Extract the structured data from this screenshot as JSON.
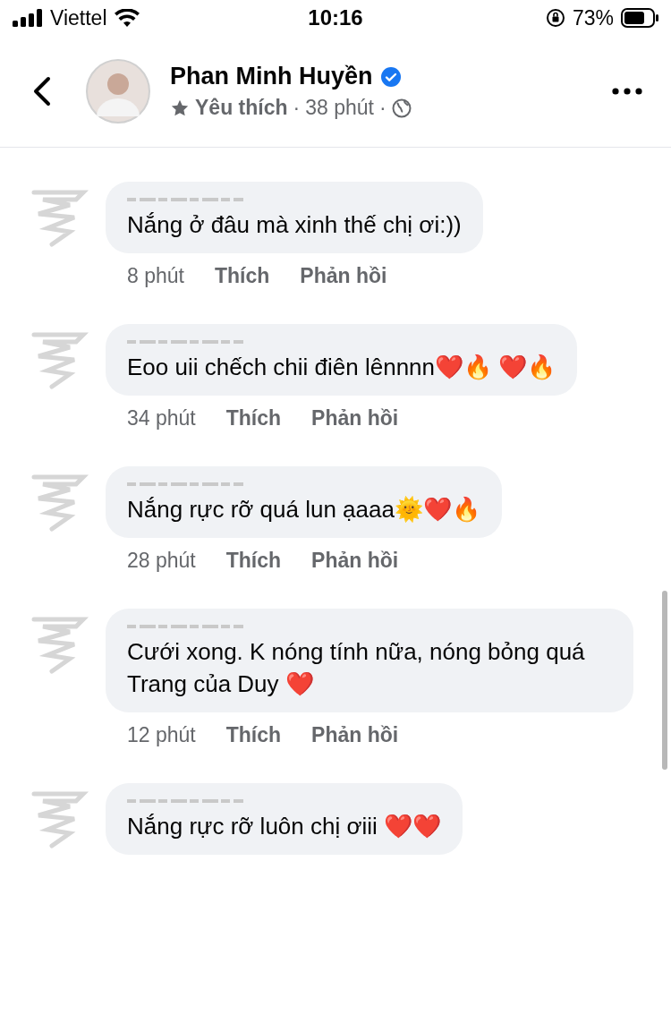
{
  "status_bar": {
    "carrier": "Viettel",
    "time": "10:16",
    "battery": "73%"
  },
  "header": {
    "name": "Phan Minh Huyền",
    "verified": true,
    "subtitle": "Yêu thích",
    "time": "38 phút",
    "separator": "·"
  },
  "comments": [
    {
      "text": "Nắng ở đâu mà xinh thế chị ơi:))",
      "time": "8 phút",
      "like": "Thích",
      "reply": "Phản hồi"
    },
    {
      "text": "Eoo uii chếch chii điên lênnnn❤️🔥 ❤️🔥",
      "time": "34 phút",
      "like": "Thích",
      "reply": "Phản hồi"
    },
    {
      "text": "Nắng rực rỡ quá lun ạaaa🌞❤️🔥",
      "time": "28 phút",
      "like": "Thích",
      "reply": "Phản hồi"
    },
    {
      "text": "Cưới xong. K nóng tính nữa, nóng bỏng quá Trang của Duy ❤️",
      "time": "12 phút",
      "like": "Thích",
      "reply": "Phản hồi"
    },
    {
      "text": "Nắng rực rỡ luôn chị ơiii ❤️❤️"
    }
  ]
}
